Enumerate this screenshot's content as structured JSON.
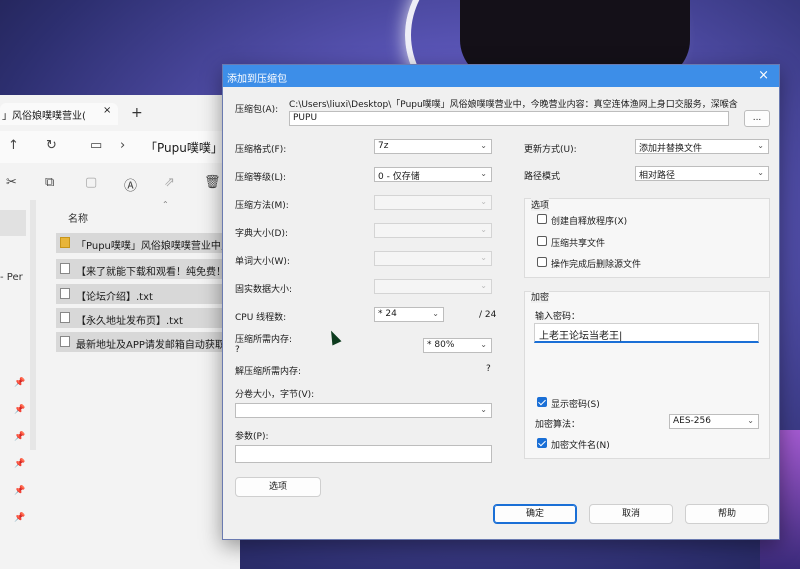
{
  "explorer": {
    "tab_title": "」风俗娘噗噗营业(",
    "tab_close": "×",
    "new_tab": "+",
    "breadcrumb": "「Pupu噗噗」风",
    "side_label": "- Per",
    "column_name": "名称",
    "files": [
      {
        "name": "「Pupu噗噗」风俗娘噗噗营业中,",
        "type": "folder"
      },
      {
        "name": "【来了就能下载和观看！纯免费！",
        "type": "file"
      },
      {
        "name": "【论坛介绍】.txt",
        "type": "file"
      },
      {
        "name": "【永久地址发布页】.txt",
        "type": "file"
      },
      {
        "name": "最新地址及APP请发邮箱自动获取",
        "type": "file"
      }
    ]
  },
  "dialog": {
    "title": "添加到压缩包",
    "close": "×",
    "archive_label": "压缩包(A):",
    "archive_path": "C:\\Users\\liuxi\\Desktop\\「Pupu噗噗」风俗娘噗噗营业中，今晚营业内容：真空连体渔网上身口交服务，深喉含",
    "archive_name": "PUPU",
    "browse": "...",
    "format_label": "压缩格式(F):",
    "format_value": "7z",
    "level_label": "压缩等级(L):",
    "level_value": "0 - 仅存储",
    "method_label": "压缩方法(M):",
    "dict_label": "字典大小(D):",
    "word_label": "单词大小(W):",
    "solid_label": "固实数据大小:",
    "threads_label": "CPU 线程数:",
    "threads_value": "* 24",
    "threads_max": "/ 24",
    "mem_comp_label": "压缩所需内存:",
    "mem_comp_q": "?",
    "mem_comp_value": "* 80%",
    "mem_decomp_label": "解压缩所需内存:",
    "mem_decomp_q": "?",
    "split_label": "分卷大小，字节(V):",
    "params_label": "参数(P):",
    "options_btn": "选项",
    "update_label": "更新方式(U):",
    "update_value": "添加并替换文件",
    "path_label": "路径模式",
    "path_value": "相对路径",
    "opts_group": "选项",
    "opt_sfx": "创建自释放程序(X)",
    "opt_shared": "压缩共享文件",
    "opt_delete": "操作完成后删除源文件",
    "enc_group": "加密",
    "enc_pwd_label": "输入密码：",
    "enc_pwd_value": "上老王论坛当老王|",
    "enc_show": "显示密码(S)",
    "enc_method_label": "加密算法：",
    "enc_method_value": "AES-256",
    "enc_names": "加密文件名(N)",
    "ok": "确定",
    "cancel": "取消",
    "help": "帮助"
  }
}
